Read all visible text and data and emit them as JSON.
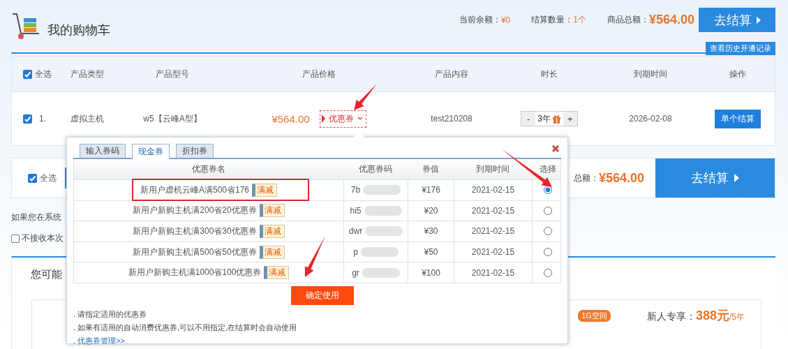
{
  "header": {
    "title": "我的购物车",
    "balance_label": "当前余额：",
    "balance": "¥0",
    "count_label": "结算数量：",
    "count": "1个",
    "total_label": "商品总额：",
    "total": "¥564.00",
    "checkout": "去结算",
    "history": "查看历史开通记录"
  },
  "table": {
    "select_all": {
      "label": "全选",
      "checked": true
    },
    "columns": [
      "产品类型",
      "产品型号",
      "产品价格",
      "产品内容",
      "时长",
      "到期时间",
      "操作"
    ],
    "rows": [
      {
        "checked": true,
        "index": "1.",
        "type": "虚拟主机",
        "model": "w5【云峰A型】",
        "price": "¥564.00",
        "coupon": "优惠券",
        "content": "test210208",
        "minus": "-",
        "duration": "3年",
        "plus": "+",
        "expiry": "2026-02-08",
        "action": "单个结算"
      }
    ]
  },
  "footer_bar": {
    "select_all": {
      "label": "全选",
      "checked": true
    },
    "total_label": "总额：",
    "total": "¥564.00",
    "checkout": "去结算"
  },
  "notice": "如果您在系统",
  "opt_out": {
    "label": "不接收本次",
    "checked": false
  },
  "recommend": {
    "title": "您可能",
    "badge": "1G空间",
    "offer_label": "新人专享：",
    "offer_price": "388元",
    "offer_unit": "/5年"
  },
  "coupon_dialog": {
    "tabs": [
      {
        "label": "输入券码",
        "selected": false
      },
      {
        "label": "现金券",
        "selected": true
      },
      {
        "label": "折扣券",
        "selected": false
      }
    ],
    "columns": [
      "优惠券名",
      "优惠券码",
      "券值",
      "到期时间",
      "选择"
    ],
    "rows": [
      {
        "name": "新用户虚机云峰A满500省176",
        "tag": "满减",
        "code": "7b",
        "value": "¥176",
        "expiry": "2021-02-15",
        "selected": true
      },
      {
        "name": "新用户新购主机满200省20优惠券",
        "tag": "满减",
        "code": "hi5",
        "value": "¥20",
        "expiry": "2021-02-15",
        "selected": false
      },
      {
        "name": "新用户新购主机满300省30优惠券",
        "tag": "满减",
        "code": "dwr",
        "value": "¥30",
        "expiry": "2021-02-15",
        "selected": false
      },
      {
        "name": "新用户新购主机满500省50优惠券",
        "tag": "满减",
        "code": "p",
        "value": "¥50",
        "expiry": "2021-02-15",
        "selected": false
      },
      {
        "name": "新用户新购主机满1000省100优惠券",
        "tag": "满减",
        "code": "gr",
        "value": "¥100",
        "expiry": "2021-02-15",
        "selected": false
      }
    ],
    "confirm": "确定使用",
    "notes": [
      {
        "kind": "text",
        "text": ". 请指定适用的优惠券"
      },
      {
        "kind": "text",
        "text": ". 如果有适用的自动消费优惠券,可以不用指定,在结算时会自动使用"
      },
      {
        "kind": "link",
        "text": ". 优惠券管理>>"
      }
    ]
  },
  "annotations": [
    {
      "kind": "arrow"
    },
    {
      "kind": "arrow"
    },
    {
      "kind": "arrow"
    },
    {
      "kind": "highlight"
    }
  ]
}
